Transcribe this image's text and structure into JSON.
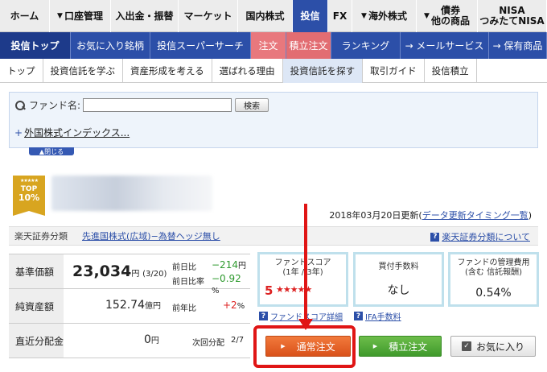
{
  "top_nav": [
    {
      "label": "ホーム",
      "arrow": false,
      "active": false
    },
    {
      "label": "口座管理",
      "arrow": true,
      "active": false
    },
    {
      "label": "入出金・振替",
      "arrow": false,
      "active": false
    },
    {
      "label": "マーケット",
      "arrow": false,
      "active": false
    },
    {
      "label": "国内株式",
      "arrow": false,
      "active": false
    },
    {
      "label": "投信",
      "arrow": false,
      "active": true
    },
    {
      "label": "FX",
      "arrow": false,
      "active": false
    },
    {
      "label": "海外株式",
      "arrow": true,
      "active": false
    },
    {
      "label": "債券\n他の商品",
      "arrow": true,
      "active": false
    },
    {
      "label": "NISA\nつみたてNISA",
      "arrow": false,
      "active": false
    }
  ],
  "sub_nav": [
    {
      "label": "投信トップ",
      "style": "active"
    },
    {
      "label": "お気に入り銘柄",
      "style": ""
    },
    {
      "label": "投信スーパーサーチ",
      "style": ""
    },
    {
      "label": "注文",
      "style": "order"
    },
    {
      "label": "積立注文",
      "style": "order2"
    },
    {
      "label": "ランキング",
      "style": ""
    },
    {
      "label": "→ メールサービス",
      "style": ""
    },
    {
      "label": "→ 保有商品",
      "style": ""
    }
  ],
  "tertiary_nav": [
    {
      "label": "トップ",
      "active": false
    },
    {
      "label": "投資信託を学ぶ",
      "active": false
    },
    {
      "label": "資産形成を考える",
      "active": false
    },
    {
      "label": "選ばれる理由",
      "active": false
    },
    {
      "label": "投資信託を探す",
      "active": true
    },
    {
      "label": "取引ガイド",
      "active": false
    },
    {
      "label": "投信積立",
      "active": false
    }
  ],
  "search": {
    "label": "ファンド名:",
    "value": "",
    "button": "検索",
    "link_bullet": "+",
    "link": "外国株式インデックス...",
    "close_tab": "▲閉じる"
  },
  "fund": {
    "badge_stars": "★★★★★",
    "badge_top": "TOP",
    "badge_pct": "10%",
    "updated_date": "2018年03月20日更新(",
    "updated_link": "データ更新タイミング一覧",
    "updated_close": ")",
    "category_label": "楽天証券分類",
    "category_value": "先進国株式(広域)−為替ヘッジ無し",
    "category_help": "楽天証券分類について"
  },
  "price": {
    "nav_label": "基準価額",
    "nav_value": "23,034",
    "nav_unit": "円",
    "nav_date": "(3/20)",
    "change_label": "前日比",
    "change_value": "−214",
    "change_unit": "円",
    "change_rate_label": "前日比率",
    "change_rate_value": "−0.92",
    "change_rate_unit": "%",
    "assets_label": "純資産額",
    "assets_value": "152.74",
    "assets_unit": "億円",
    "yoy_label": "前年比",
    "yoy_value": "+2",
    "yoy_unit": "%",
    "dividend_label": "直近分配金",
    "dividend_value": "0",
    "dividend_unit": "円",
    "next_div_label": "次回分配",
    "next_div_value": "2/7"
  },
  "info_boxes": {
    "score_title": "ファンドスコア\n(1年 / 3年)",
    "score_value": "5",
    "score_stars": "★★★★★",
    "fee_title": "買付手数料",
    "fee_value": "なし",
    "mgmt_title": "ファンドの管理費用\n(含む 信託報酬)",
    "mgmt_value": "0.54%",
    "score_detail_link": "ファンドスコア詳細",
    "ifa_link": "IFA手数料"
  },
  "buttons": {
    "normal_order": "通常注文",
    "accumulation_order": "積立注文",
    "favorite": "お気に入り",
    "arrow_glyph": "▶",
    "check_glyph": "✓"
  },
  "colors": {
    "brand_blue": "#2c4fa8",
    "order_orange": "#e8642a",
    "accumulation_green": "#52ab3a",
    "annotation_red": "#e01515"
  }
}
